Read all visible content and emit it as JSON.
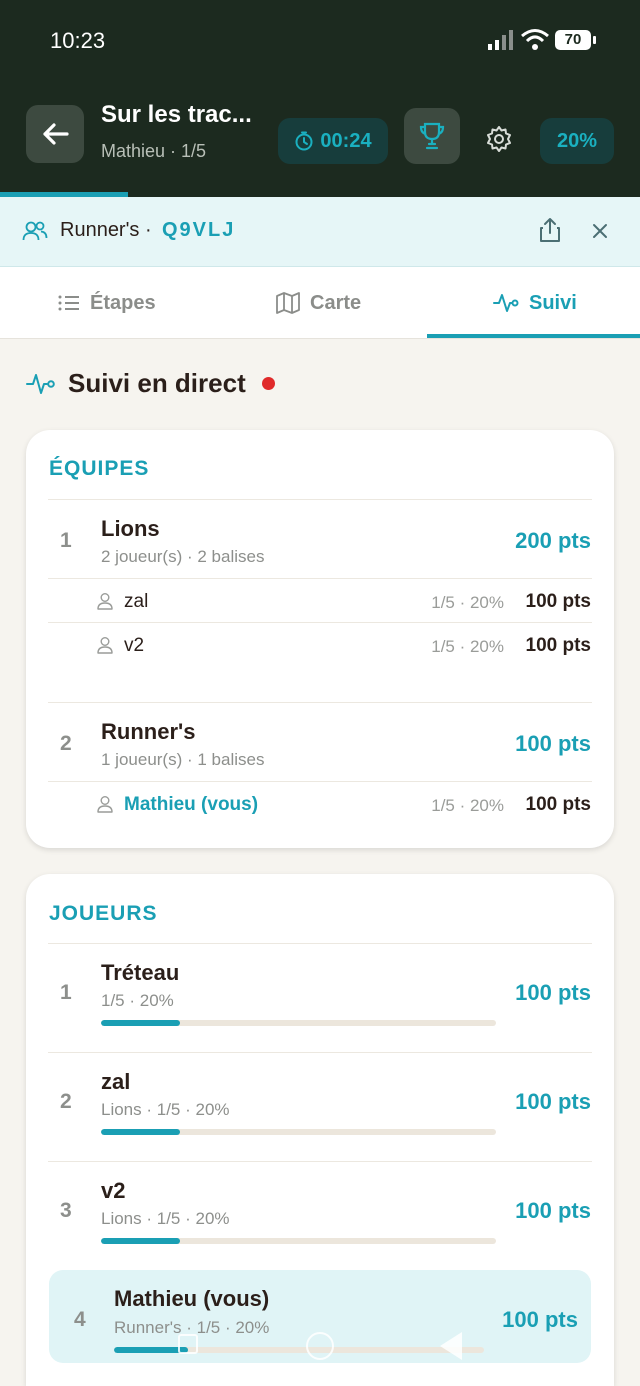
{
  "status_bar": {
    "time": "10:23",
    "battery": "70"
  },
  "header": {
    "title": "Sur les trac...",
    "subtitle": "Mathieu · 1/5",
    "timer": "00:24",
    "percent": "20%",
    "progress": 0.2
  },
  "team_banner": {
    "label": "Runner's ·",
    "code": "Q9VLJ"
  },
  "tabs": [
    {
      "label": "Étapes",
      "icon": "list-icon",
      "active": false
    },
    {
      "label": "Carte",
      "icon": "map-icon",
      "active": false
    },
    {
      "label": "Suivi",
      "icon": "activity-icon",
      "active": true
    }
  ],
  "live": {
    "title": "Suivi en direct"
  },
  "teams": {
    "heading": "ÉQUIPES",
    "items": [
      {
        "rank": "1",
        "name": "Lions",
        "meta": "2 joueur(s) · 2 balises",
        "points": "200 pts",
        "members": [
          {
            "name": "zal",
            "progress": "1/5 · 20%",
            "points": "100 pts"
          },
          {
            "name": "v2",
            "progress": "1/5 · 20%",
            "points": "100 pts"
          }
        ]
      },
      {
        "rank": "2",
        "name": "Runner's",
        "meta": "1 joueur(s) · 1 balises",
        "points": "100 pts",
        "members": [
          {
            "name": "Mathieu (vous)",
            "progress": "1/5 · 20%",
            "points": "100 pts"
          }
        ]
      }
    ]
  },
  "players": {
    "heading": "JOUEURS",
    "items": [
      {
        "rank": "1",
        "name": "Tréteau",
        "meta": "1/5 · 20%",
        "points": "100 pts",
        "progress": 0.2
      },
      {
        "rank": "2",
        "name": "zal",
        "meta": "Lions · 1/5 · 20%",
        "points": "100 pts",
        "progress": 0.2
      },
      {
        "rank": "3",
        "name": "v2",
        "meta": "Lions · 1/5 · 20%",
        "points": "100 pts",
        "progress": 0.2
      },
      {
        "rank": "4",
        "name": "Mathieu (vous)",
        "meta": "Runner's · 1/5 · 20%",
        "points": "100 pts",
        "progress": 0.2
      }
    ]
  },
  "colors": {
    "accent": "#1a9fb4",
    "header_bg": "#1c2a1f",
    "live_dot": "#e02a2a"
  }
}
